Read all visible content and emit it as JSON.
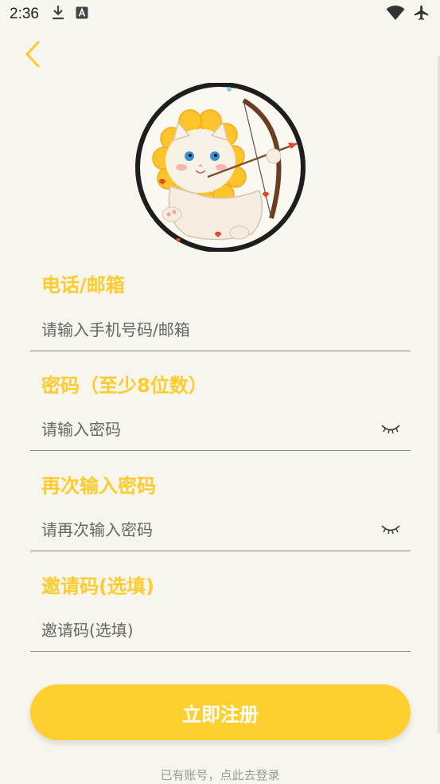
{
  "status_bar": {
    "time": "2:36",
    "icons": [
      "download-icon",
      "text-a-icon",
      "wifi-icon",
      "airplane-icon"
    ]
  },
  "back_icon": "chevron-left-icon",
  "theme": {
    "accent": "#fccb2c",
    "button": "#fdd02f",
    "background": "#f8f5ee"
  },
  "form": {
    "phone_label": "电话/邮箱",
    "phone_placeholder": "请输入手机号码/邮箱",
    "password_label": "密码（至少8位数）",
    "password_placeholder": "请输入密码",
    "confirm_label": "再次输入密码",
    "confirm_placeholder": "请再次输入密码",
    "invite_label": "邀请码(选填)",
    "invite_placeholder": "邀请码(选填)"
  },
  "register_button": "立即注册",
  "login_link": "已有账号，点此去登录"
}
